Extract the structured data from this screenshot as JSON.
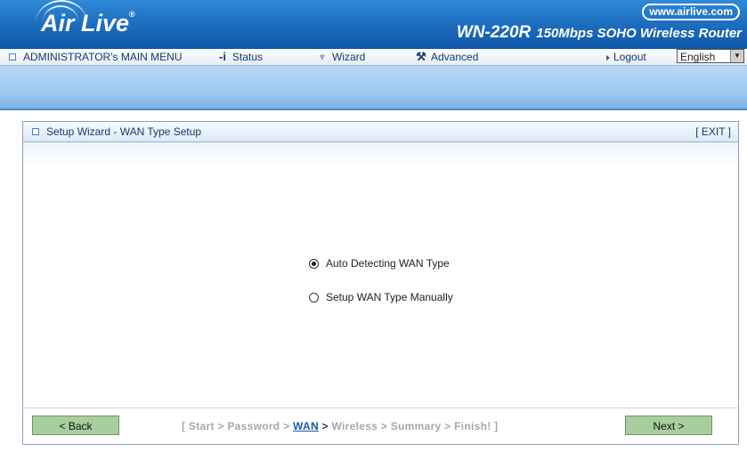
{
  "header": {
    "logo_text": "Air Live",
    "logo_reg": "®",
    "site_link": "www.airlive.com",
    "model": "WN-220R",
    "model_desc": "150Mbps SOHO Wireless Router"
  },
  "menu": {
    "main": "ADMINISTRATOR's MAIN MENU",
    "status": "Status",
    "wizard": "Wizard",
    "advanced": "Advanced",
    "logout": "Logout",
    "language": "English"
  },
  "panel": {
    "title": "Setup Wizard - WAN Type Setup",
    "exit": "[ EXIT ]",
    "options": [
      {
        "label": "Auto Detecting WAN Type",
        "selected": true
      },
      {
        "label": "Setup WAN Type Manually",
        "selected": false
      }
    ]
  },
  "footer": {
    "back": "< Back",
    "next": "Next >",
    "steps_prefix": "[ Start > Password > ",
    "steps_current": "WAN",
    "steps_arrow": " > ",
    "steps_suffix": "Wireless > Summary > Finish! ]"
  },
  "colors": {
    "header_blue": "#1e6fc0",
    "button_green": "#a8ce9e",
    "current_step": "#1a5ab0"
  }
}
